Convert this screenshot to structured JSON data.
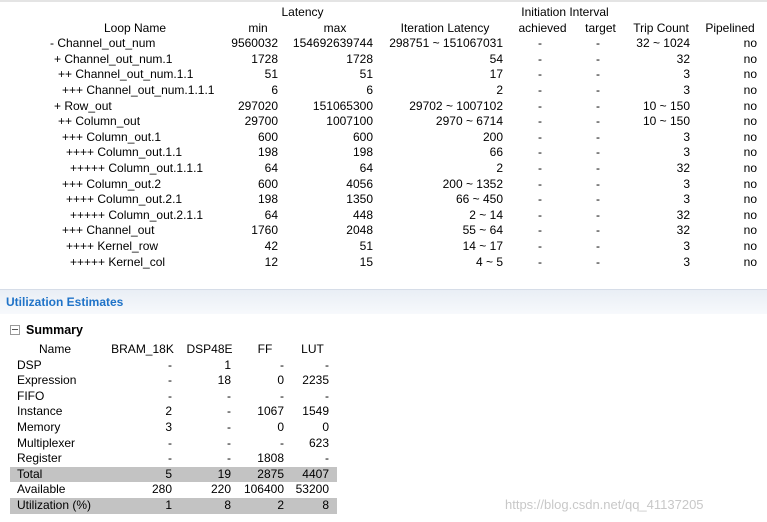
{
  "loops": {
    "group_headers": {
      "latency": "Latency",
      "initiation_interval": "Initiation Interval"
    },
    "columns": [
      "Loop Name",
      "min",
      "max",
      "Iteration Latency",
      "achieved",
      "target",
      "Trip Count",
      "Pipelined"
    ],
    "rows": [
      {
        "name": "- Channel_out_num",
        "level": 0,
        "min": "9560032",
        "max": "154692639744",
        "iter": "298751 ~ 151067031",
        "achieved": "-",
        "target": "-",
        "trip": "32 ~ 1024",
        "pipelined": "no"
      },
      {
        "name": "+ Channel_out_num.1",
        "level": 1,
        "min": "1728",
        "max": "1728",
        "iter": "54",
        "achieved": "-",
        "target": "-",
        "trip": "32",
        "pipelined": "no"
      },
      {
        "name": "++ Channel_out_num.1.1",
        "level": 2,
        "min": "51",
        "max": "51",
        "iter": "17",
        "achieved": "-",
        "target": "-",
        "trip": "3",
        "pipelined": "no"
      },
      {
        "name": "+++ Channel_out_num.1.1.1",
        "level": 3,
        "min": "6",
        "max": "6",
        "iter": "2",
        "achieved": "-",
        "target": "-",
        "trip": "3",
        "pipelined": "no"
      },
      {
        "name": "+ Row_out",
        "level": 1,
        "min": "297020",
        "max": "151065300",
        "iter": "29702 ~ 1007102",
        "achieved": "-",
        "target": "-",
        "trip": "10 ~ 150",
        "pipelined": "no"
      },
      {
        "name": "++ Column_out",
        "level": 2,
        "min": "29700",
        "max": "1007100",
        "iter": "2970 ~ 6714",
        "achieved": "-",
        "target": "-",
        "trip": "10 ~ 150",
        "pipelined": "no"
      },
      {
        "name": "+++ Column_out.1",
        "level": 3,
        "min": "600",
        "max": "600",
        "iter": "200",
        "achieved": "-",
        "target": "-",
        "trip": "3",
        "pipelined": "no"
      },
      {
        "name": "++++ Column_out.1.1",
        "level": 4,
        "min": "198",
        "max": "198",
        "iter": "66",
        "achieved": "-",
        "target": "-",
        "trip": "3",
        "pipelined": "no"
      },
      {
        "name": "+++++ Column_out.1.1.1",
        "level": 5,
        "min": "64",
        "max": "64",
        "iter": "2",
        "achieved": "-",
        "target": "-",
        "trip": "32",
        "pipelined": "no"
      },
      {
        "name": "+++ Column_out.2",
        "level": 3,
        "min": "600",
        "max": "4056",
        "iter": "200 ~ 1352",
        "achieved": "-",
        "target": "-",
        "trip": "3",
        "pipelined": "no"
      },
      {
        "name": "++++ Column_out.2.1",
        "level": 4,
        "min": "198",
        "max": "1350",
        "iter": "66 ~ 450",
        "achieved": "-",
        "target": "-",
        "trip": "3",
        "pipelined": "no"
      },
      {
        "name": "+++++ Column_out.2.1.1",
        "level": 5,
        "min": "64",
        "max": "448",
        "iter": "2 ~ 14",
        "achieved": "-",
        "target": "-",
        "trip": "32",
        "pipelined": "no"
      },
      {
        "name": "+++ Channel_out",
        "level": 3,
        "min": "1760",
        "max": "2048",
        "iter": "55 ~ 64",
        "achieved": "-",
        "target": "-",
        "trip": "32",
        "pipelined": "no"
      },
      {
        "name": "++++ Kernel_row",
        "level": 4,
        "min": "42",
        "max": "51",
        "iter": "14 ~ 17",
        "achieved": "-",
        "target": "-",
        "trip": "3",
        "pipelined": "no"
      },
      {
        "name": "+++++ Kernel_col",
        "level": 5,
        "min": "12",
        "max": "15",
        "iter": "4 ~ 5",
        "achieved": "-",
        "target": "-",
        "trip": "3",
        "pipelined": "no"
      }
    ]
  },
  "utilization": {
    "title": "Utilization Estimates",
    "summary_label": "Summary",
    "columns": [
      "Name",
      "BRAM_18K",
      "DSP48E",
      "FF",
      "LUT"
    ],
    "rows": [
      {
        "name": "DSP",
        "bram": "-",
        "dsp": "1",
        "ff": "-",
        "lut": "-",
        "highlight": false
      },
      {
        "name": "Expression",
        "bram": "-",
        "dsp": "18",
        "ff": "0",
        "lut": "2235",
        "highlight": false
      },
      {
        "name": "FIFO",
        "bram": "-",
        "dsp": "-",
        "ff": "-",
        "lut": "-",
        "highlight": false
      },
      {
        "name": "Instance",
        "bram": "2",
        "dsp": "-",
        "ff": "1067",
        "lut": "1549",
        "highlight": false
      },
      {
        "name": "Memory",
        "bram": "3",
        "dsp": "-",
        "ff": "0",
        "lut": "0",
        "highlight": false
      },
      {
        "name": "Multiplexer",
        "bram": "-",
        "dsp": "-",
        "ff": "-",
        "lut": "623",
        "highlight": false
      },
      {
        "name": "Register",
        "bram": "-",
        "dsp": "-",
        "ff": "1808",
        "lut": "-",
        "highlight": false
      },
      {
        "name": "Total",
        "bram": "5",
        "dsp": "19",
        "ff": "2875",
        "lut": "4407",
        "highlight": true
      },
      {
        "name": "Available",
        "bram": "280",
        "dsp": "220",
        "ff": "106400",
        "lut": "53200",
        "highlight": false
      },
      {
        "name": "Utilization (%)",
        "bram": "1",
        "dsp": "8",
        "ff": "2",
        "lut": "8",
        "highlight": true
      }
    ]
  },
  "watermark": "https://blog.csdn.net/qq_41137205",
  "colors": {
    "section_title": "#1f73c8",
    "highlight_row": "#c3c3c3"
  }
}
